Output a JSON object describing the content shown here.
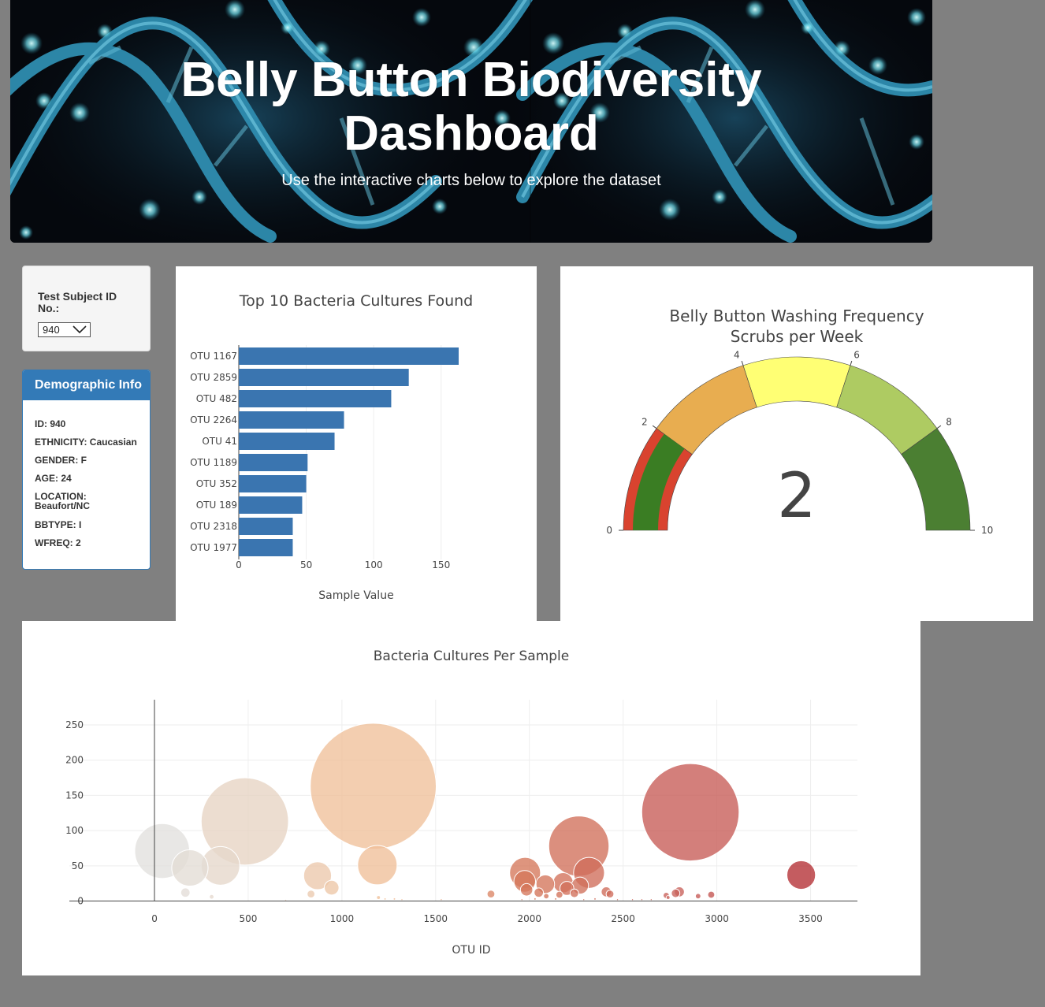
{
  "header": {
    "title_line1": "Belly Button Biodiversity",
    "title_line2": "Dashboard",
    "subtitle": "Use the interactive charts below to explore the dataset"
  },
  "selector": {
    "label": "Test Subject ID No.:",
    "selected": "940"
  },
  "demographics": {
    "title": "Demographic Info",
    "items": [
      "ID: 940",
      "ETHNICITY: Caucasian",
      "GENDER: F",
      "AGE: 24",
      "LOCATION: Beaufort/NC",
      "BBTYPE: I",
      "WFREQ: 2"
    ]
  },
  "colors": {
    "bar": "#3a75b0",
    "panel_header": "#337ab7",
    "page_background": "#808080",
    "gauge_needle": "#e04434",
    "gauge_value_band": "#3a7d23"
  },
  "chart_data": [
    {
      "type": "bar",
      "orientation": "horizontal",
      "title": "Top 10 Bacteria Cultures Found",
      "xlabel": "Sample Value",
      "categories": [
        "OTU 1167",
        "OTU 2859",
        "OTU 482",
        "OTU 2264",
        "OTU 41",
        "OTU 1189",
        "OTU 352",
        "OTU 189",
        "OTU 2318",
        "OTU 1977"
      ],
      "values": [
        163,
        126,
        113,
        78,
        71,
        51,
        50,
        47,
        40,
        40
      ],
      "xticks": [
        0,
        50,
        100,
        150
      ],
      "xlim": [
        0,
        170
      ],
      "grid": true
    },
    {
      "type": "gauge",
      "title_line1": "Belly Button Washing Frequency",
      "title_line2": "Scrubs per Week",
      "value": 2,
      "range": [
        0,
        10
      ],
      "ticks": [
        0,
        2,
        4,
        6,
        8,
        10
      ],
      "steps": [
        {
          "range": [
            0,
            2
          ],
          "color": "#d9432f"
        },
        {
          "range": [
            2,
            4
          ],
          "color": "#e8ad50"
        },
        {
          "range": [
            4,
            6
          ],
          "color": "#ffff74"
        },
        {
          "range": [
            6,
            8
          ],
          "color": "#aecb62"
        },
        {
          "range": [
            8,
            10
          ],
          "color": "#4b7f32"
        }
      ]
    },
    {
      "type": "scatter",
      "title": "Bacteria Cultures Per Sample",
      "xlabel": "OTU ID",
      "xticks": [
        0,
        500,
        1000,
        1500,
        2000,
        2500,
        3000,
        3500
      ],
      "yticks": [
        0,
        50,
        100,
        150,
        200,
        250
      ],
      "xlim": [
        -370,
        3750
      ],
      "ylim": [
        -5,
        297
      ],
      "grid": true,
      "points": [
        {
          "x": 41,
          "y": 71
        },
        {
          "x": 189,
          "y": 47
        },
        {
          "x": 352,
          "y": 50
        },
        {
          "x": 482,
          "y": 113
        },
        {
          "x": 1167,
          "y": 163
        },
        {
          "x": 1189,
          "y": 51
        },
        {
          "x": 1977,
          "y": 40
        },
        {
          "x": 2264,
          "y": 78
        },
        {
          "x": 2318,
          "y": 40
        },
        {
          "x": 2859,
          "y": 126
        },
        {
          "x": 3450,
          "y": 37
        },
        {
          "x": 870,
          "y": 36
        },
        {
          "x": 945,
          "y": 19
        },
        {
          "x": 165,
          "y": 12
        },
        {
          "x": 1975,
          "y": 28
        },
        {
          "x": 2085,
          "y": 24
        },
        {
          "x": 2180,
          "y": 26
        },
        {
          "x": 1985,
          "y": 16
        },
        {
          "x": 2200,
          "y": 18
        },
        {
          "x": 2270,
          "y": 22
        },
        {
          "x": 2050,
          "y": 12
        },
        {
          "x": 2240,
          "y": 11
        },
        {
          "x": 2410,
          "y": 13
        },
        {
          "x": 2430,
          "y": 10
        },
        {
          "x": 2800,
          "y": 13
        },
        {
          "x": 2780,
          "y": 11
        },
        {
          "x": 2970,
          "y": 9
        },
        {
          "x": 1795,
          "y": 10
        },
        {
          "x": 2730,
          "y": 8
        },
        {
          "x": 2900,
          "y": 7
        },
        {
          "x": 835,
          "y": 10
        },
        {
          "x": 305,
          "y": 6
        },
        {
          "x": 1195,
          "y": 5
        },
        {
          "x": 2090,
          "y": 7
        },
        {
          "x": 2160,
          "y": 9
        },
        {
          "x": 2740,
          "y": 5
        },
        {
          "x": 2350,
          "y": 3
        },
        {
          "x": 1280,
          "y": 3
        },
        {
          "x": 1320,
          "y": 2
        },
        {
          "x": 2600,
          "y": 2
        },
        {
          "x": 2650,
          "y": 2
        },
        {
          "x": 1530,
          "y": 2
        },
        {
          "x": 1230,
          "y": 3
        },
        {
          "x": 700,
          "y": 1
        },
        {
          "x": 2140,
          "y": 3
        },
        {
          "x": 2470,
          "y": 2
        },
        {
          "x": 2550,
          "y": 2
        },
        {
          "x": 1960,
          "y": 2
        },
        {
          "x": 2030,
          "y": 3
        },
        {
          "x": 2290,
          "y": 2
        }
      ]
    }
  ]
}
